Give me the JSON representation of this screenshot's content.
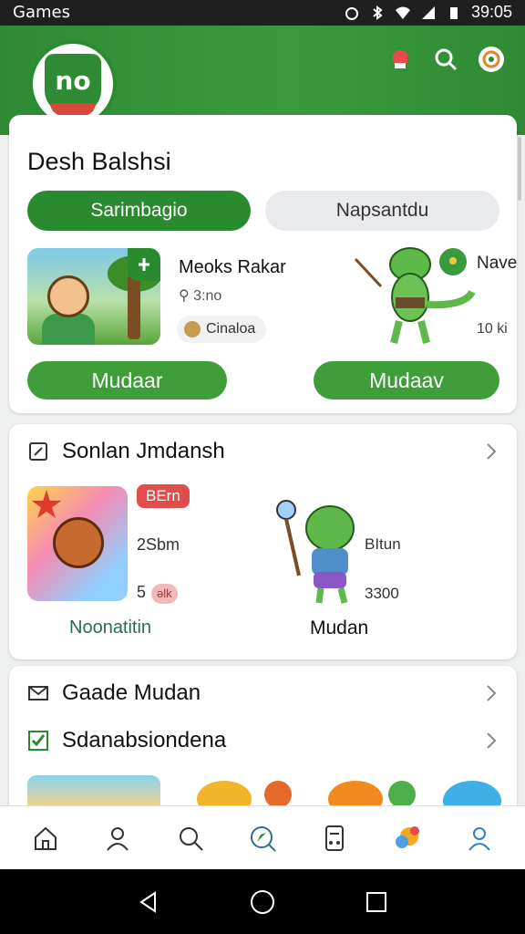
{
  "status_bar": {
    "left_text": "Games",
    "time": "39:05"
  },
  "header": {
    "logo_text": "no",
    "icons": [
      "notification-icon",
      "search-icon",
      "profile-icon"
    ]
  },
  "featured": {
    "title": "Desh Balshsi",
    "segments": {
      "active": "Sarimbagio",
      "inactive": "Napsantdu"
    },
    "item1": {
      "title": "Meoks Rakar",
      "meta": "3:no",
      "chip": "Cinaloa",
      "button": "Mudaar"
    },
    "item2": {
      "title": "Nave",
      "meta": "10 ki",
      "button": "Mudaav"
    }
  },
  "section1": {
    "title": "Sonlan Jmdansh",
    "tile1": {
      "badge": "BErn",
      "meta1": "2Sbm",
      "meta2": "5",
      "pill": "ǝlk",
      "caption": "Noonatitin"
    },
    "tile2": {
      "meta1": "BItun",
      "meta2": "3300",
      "caption": "Mudan"
    }
  },
  "section2": {
    "row1": "Gaade Mudan",
    "row2": "Sdanabsiondena"
  },
  "bottom_nav": [
    "home-icon",
    "profile-outline-icon",
    "search-icon",
    "explore-icon",
    "device-icon",
    "games-icon",
    "account-icon"
  ],
  "colors": {
    "primary_green": "#2a8a30",
    "button_green": "#3f9e3a",
    "badge_red": "#e14c4c"
  }
}
